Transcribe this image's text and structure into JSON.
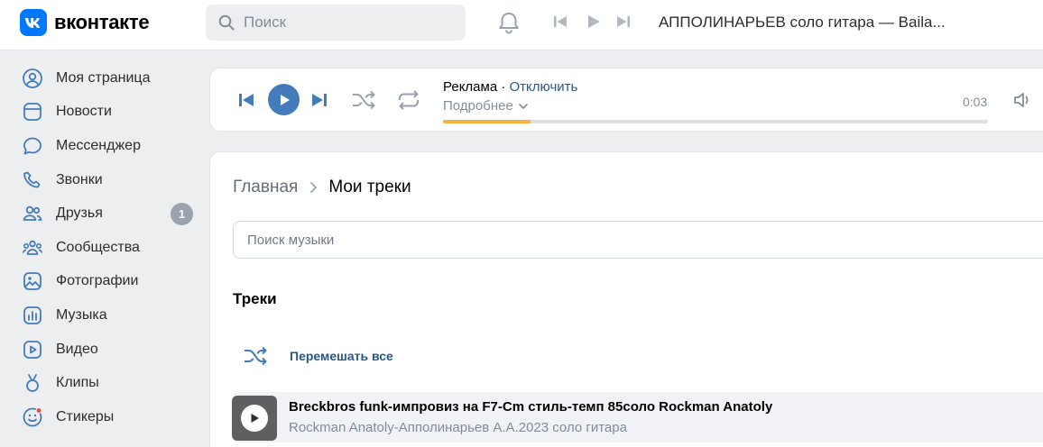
{
  "header": {
    "logo_text": "вконтакте",
    "search_placeholder": "Поиск",
    "now_playing": "АППОЛИНАРЬЕВ соло гитара — Baila..."
  },
  "sidebar": {
    "items": [
      {
        "label": "Моя страница",
        "icon": "user-circle-icon"
      },
      {
        "label": "Новости",
        "icon": "news-icon"
      },
      {
        "label": "Мессенджер",
        "icon": "message-icon"
      },
      {
        "label": "Звонки",
        "icon": "phone-icon"
      },
      {
        "label": "Друзья",
        "icon": "friends-icon",
        "badge": "1"
      },
      {
        "label": "Сообщества",
        "icon": "communities-icon"
      },
      {
        "label": "Фотографии",
        "icon": "photos-icon"
      },
      {
        "label": "Музыка",
        "icon": "music-icon"
      },
      {
        "label": "Видео",
        "icon": "video-icon"
      },
      {
        "label": "Клипы",
        "icon": "clips-icon"
      },
      {
        "label": "Стикеры",
        "icon": "stickers-icon"
      }
    ]
  },
  "player": {
    "ad_label": "Реклама · ",
    "disable_link": "Отключить",
    "more_label": "Подробнее",
    "time": "0:03",
    "progress": 0.16
  },
  "main": {
    "breadcrumb_home": "Главная",
    "breadcrumb_current": "Мои треки",
    "search_placeholder": "Поиск музыки",
    "section_title": "Треки",
    "shuffle_label": "Перемешать все",
    "track": {
      "title": "Breckbros funk-импровиз на F7-Cm стиль-темп 85соло Rockman Anatoly",
      "artist": "Rockman Anatoly-Апполинарьев А.А.2023 соло гитара"
    }
  },
  "colors": {
    "accent": "#0077ff",
    "play_button": "#447bba",
    "link": "#2a5885",
    "progress_fill": "#f5b43d",
    "badge": "#99a2ad",
    "notification_dot": "#e64646"
  }
}
